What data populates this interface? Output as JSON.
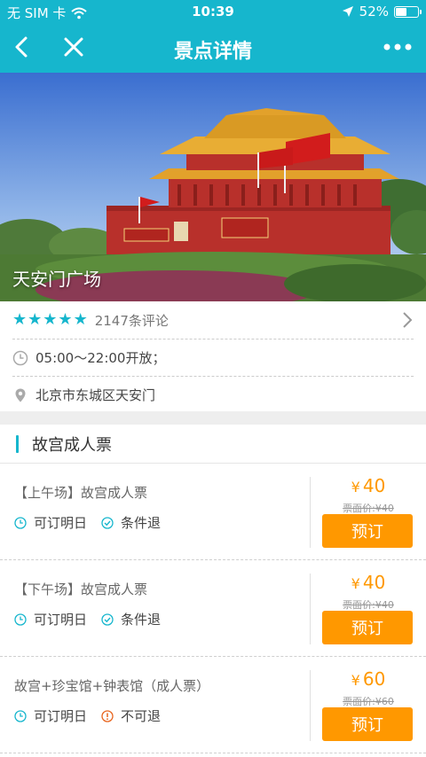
{
  "status_bar": {
    "carrier": "无 SIM 卡",
    "time": "10:39",
    "battery_percent": "52%",
    "battery_level": 0.52
  },
  "nav": {
    "title": "景点详情",
    "back_icon": "chevron-left-icon",
    "close_icon": "close-icon",
    "more_icon": "more-dots-icon"
  },
  "hero": {
    "caption": "天安门广场"
  },
  "info": {
    "rating_stars": 5,
    "reviews": "2147条评论",
    "hours": "05:00～22:00开放；",
    "address": "北京市东城区天安门"
  },
  "tickets": {
    "section_title": "故宫成人票",
    "items": [
      {
        "name": "【上午场】故宫成人票",
        "tag1": "可订明日",
        "tag2": "条件退",
        "tag2_icon": "check-circle-icon",
        "currency": "¥",
        "price": "40",
        "face": "票面价:¥40",
        "button": "预订"
      },
      {
        "name": "【下午场】故宫成人票",
        "tag1": "可订明日",
        "tag2": "条件退",
        "tag2_icon": "check-circle-icon",
        "currency": "¥",
        "price": "40",
        "face": "票面价:¥40",
        "button": "预订"
      },
      {
        "name": "故宫+珍宝馆+钟表馆（成人票）",
        "tag1": "可订明日",
        "tag2": "不可退",
        "tag2_icon": "alert-circle-icon",
        "currency": "¥",
        "price": "60",
        "face": "票面价:¥60",
        "button": "预订"
      }
    ]
  },
  "colors": {
    "brand": "#16b6cd",
    "accent": "#ff9800",
    "warning": "#e8651e"
  }
}
